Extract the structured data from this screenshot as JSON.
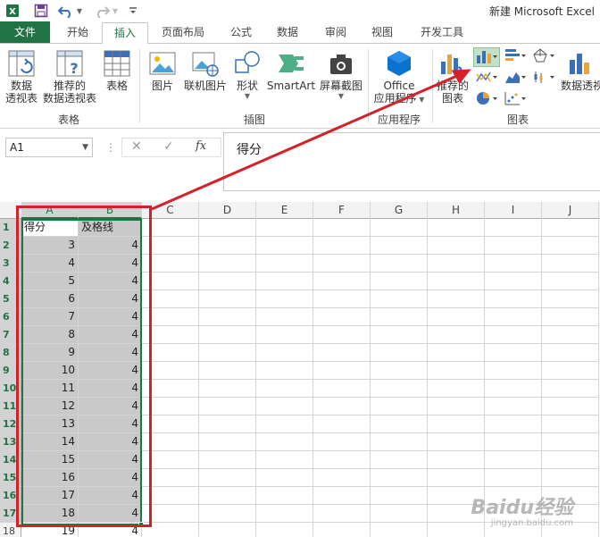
{
  "window": {
    "title": "新建 Microsoft Excel"
  },
  "tabs": [
    "文件",
    "开始",
    "插入",
    "页面布局",
    "公式",
    "数据",
    "审阅",
    "视图",
    "开发工具"
  ],
  "ribbon": {
    "tables": {
      "group_label": "表格",
      "pivot_label_1": "数据",
      "pivot_label_2": "透视表",
      "rec_pivot_label_1": "推荐的",
      "rec_pivot_label_2": "数据透视表",
      "table_label": "表格"
    },
    "illustrations": {
      "group_label": "插图",
      "picture_label": "图片",
      "online_picture_label": "联机图片",
      "shapes_label": "形状",
      "smartart_label": "SmartArt",
      "screenshot_label": "屏幕截图"
    },
    "apps": {
      "group_label": "应用程序",
      "office_label_1": "Office",
      "office_label_2": "应用程序"
    },
    "charts": {
      "group_label": "图表",
      "rec_charts_label_1": "推荐的",
      "rec_charts_label_2": "图表",
      "pivot_chart_label": "数据透视"
    }
  },
  "formula_bar": {
    "name_box": "A1",
    "content": "得分",
    "fx_label": "fx"
  },
  "grid": {
    "columns": [
      "A",
      "B",
      "C",
      "D",
      "E",
      "F",
      "G",
      "H",
      "I",
      "J"
    ],
    "rows": [
      {
        "num": "1",
        "a": "得分",
        "b": "及格线"
      },
      {
        "num": "2",
        "a": "3",
        "b": "4"
      },
      {
        "num": "3",
        "a": "4",
        "b": "4"
      },
      {
        "num": "4",
        "a": "5",
        "b": "4"
      },
      {
        "num": "5",
        "a": "6",
        "b": "4"
      },
      {
        "num": "6",
        "a": "7",
        "b": "4"
      },
      {
        "num": "7",
        "a": "8",
        "b": "4"
      },
      {
        "num": "8",
        "a": "9",
        "b": "4"
      },
      {
        "num": "9",
        "a": "10",
        "b": "4"
      },
      {
        "num": "10",
        "a": "11",
        "b": "4"
      },
      {
        "num": "11",
        "a": "12",
        "b": "4"
      },
      {
        "num": "12",
        "a": "13",
        "b": "4"
      },
      {
        "num": "13",
        "a": "14",
        "b": "4"
      },
      {
        "num": "14",
        "a": "15",
        "b": "4"
      },
      {
        "num": "15",
        "a": "16",
        "b": "4"
      },
      {
        "num": "16",
        "a": "17",
        "b": "4"
      },
      {
        "num": "17",
        "a": "18",
        "b": "4"
      },
      {
        "num": "18",
        "a": "19",
        "b": "4"
      }
    ]
  },
  "colors": {
    "excel_green": "#217346",
    "annotation_red": "#d4222b",
    "selection_gray": "#c9c9c9"
  },
  "watermark": {
    "logo": "Baidu经验",
    "url": "jingyan.baidu.com"
  }
}
